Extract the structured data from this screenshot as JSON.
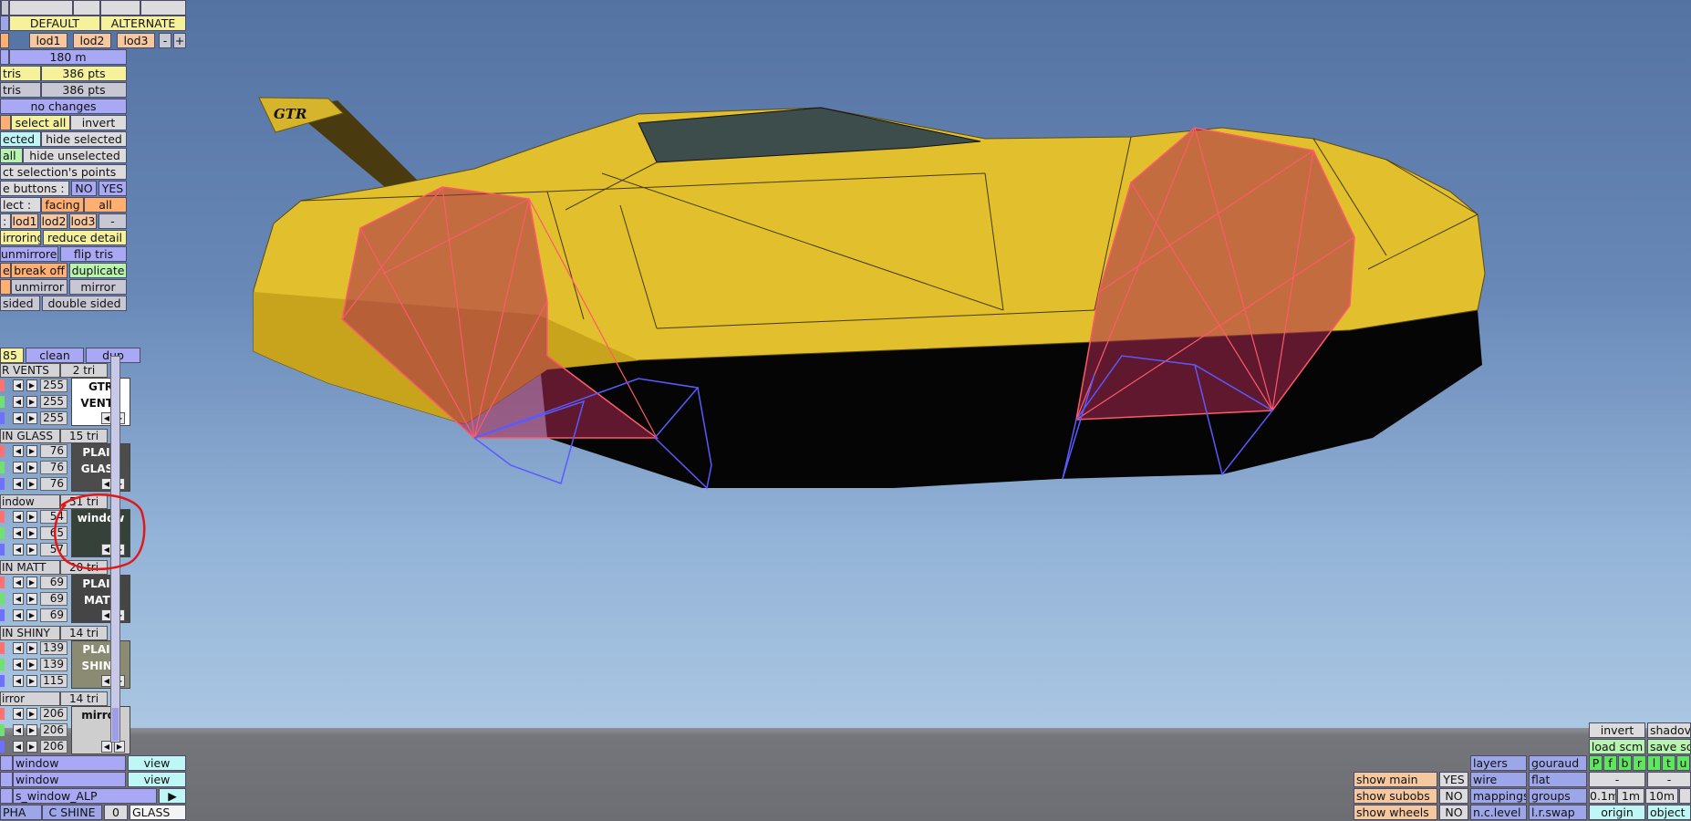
{
  "top_panel": {
    "tabs": [
      "DEFAULT",
      "ALTERNATE"
    ],
    "lods": [
      "lod1",
      "lod2",
      "lod3"
    ],
    "minus": "-",
    "plus": "+",
    "distance": "180 m",
    "tris_label_1": "tris",
    "tris_value_1": "386 pts",
    "tris_label_2": "tris",
    "tris_value_2": "386 pts",
    "no_changes": "no changes",
    "select_all": "select all",
    "invert": "invert",
    "selected_partial": "ected",
    "hide_selected": "hide selected",
    "all": "all",
    "hide_unselected": "hide unselected",
    "select_points": "ct selection's points",
    "buttons_label": "e buttons :",
    "no": "NO",
    "yes": "YES",
    "select_label": "lect :",
    "facing": "facing",
    "all2": "all",
    "colon": ":",
    "lod_dash": "-",
    "mirroring": "irroring",
    "reduce_detail": "reduce detail",
    "unmirrored": "unmirrored",
    "flip_tris": "flip tris",
    "e": "e",
    "break_off": "break off",
    "duplicate": "duplicate",
    "unmirror": "unmirror",
    "mirror": "mirror",
    "sided": "sided",
    "double_sided": "double sided"
  },
  "materials_header": {
    "count": "85",
    "clean": "clean",
    "dup": "dup"
  },
  "materials": [
    {
      "name": "R VENTS",
      "tris": "2 tri",
      "r": "255",
      "g": "255",
      "b": "255",
      "preview": [
        "GTR",
        "VENTS"
      ],
      "bg": "#ffffff",
      "fg": "#111111"
    },
    {
      "name": "IN GLASS",
      "tris": "15 tri",
      "r": "76",
      "g": "76",
      "b": "76",
      "preview": [
        "PLAIN",
        "GLASS"
      ],
      "bg": "#4c4c4c",
      "fg": "#ffffff"
    },
    {
      "name": "indow",
      "tris": "51 tri",
      "r": "54",
      "g": "65",
      "b": "57",
      "preview": [
        "window",
        ""
      ],
      "bg": "#364139",
      "fg": "#ffffff"
    },
    {
      "name": "IN MATT",
      "tris": "20 tri",
      "r": "69",
      "g": "69",
      "b": "69",
      "preview": [
        "PLAIN",
        "MATT"
      ],
      "bg": "#454545",
      "fg": "#ffffff"
    },
    {
      "name": "IN SHINY",
      "tris": "14 tri",
      "r": "139",
      "g": "139",
      "b": "115",
      "preview": [
        "PLAIN",
        "SHINY"
      ],
      "bg": "#8b8b73",
      "fg": "#ffffff"
    },
    {
      "name": "irror",
      "tris": "14 tri",
      "r": "206",
      "g": "206",
      "b": "206",
      "preview": [
        "mirror",
        ""
      ],
      "bg": "#cecece",
      "fg": "#111111"
    }
  ],
  "bottom_left": {
    "row1_name": "window",
    "row1_view": "view",
    "row2_name": "window",
    "row2_view": "view",
    "texture": "s_window_ALP",
    "play": "▶",
    "pha": "PHA",
    "c_shine": "C SHINE",
    "zero": "0",
    "glass": "GLASS"
  },
  "bottom_right": {
    "invert": "invert",
    "shadow": "shadov",
    "load_scm": "load scm",
    "save_scm": "save sc",
    "toggles": [
      "P",
      "f",
      "b",
      "r",
      "l",
      "t",
      "u"
    ],
    "dash1": "-",
    "dash2": "-",
    "layers": "layers",
    "gouraud": "gouraud",
    "show_main": "show main",
    "show_main_val": "YES",
    "wire": "wire",
    "flat": "flat",
    "show_subobs": "show subobs",
    "show_subobs_val": "NO",
    "mappings": "mappings",
    "groups": "groups",
    "g01": "0.1m",
    "g1": "1m",
    "g10": "10m",
    "show_wheels": "show wheels",
    "show_wheels_val": "NO",
    "nc_level": "n.c.level",
    "lr_swap": "l.r.swap",
    "origin": "origin",
    "object": "object"
  },
  "car": {
    "logo_text": "GTR",
    "body_color": "#e2bf2c"
  }
}
